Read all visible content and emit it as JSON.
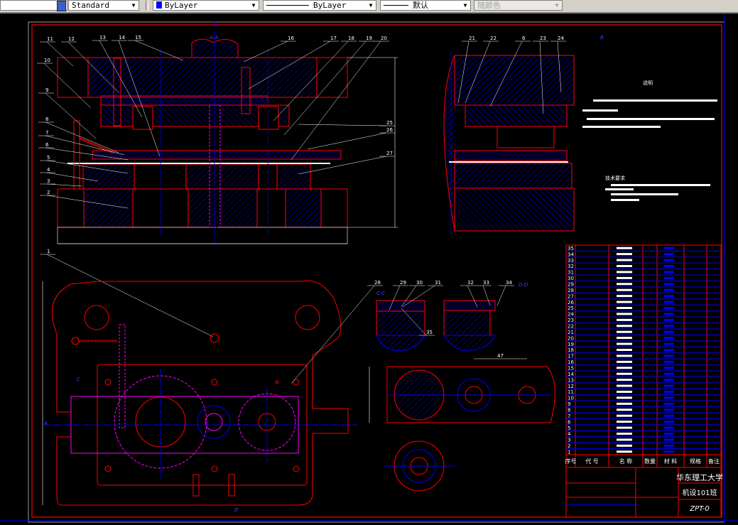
{
  "toolbar": {
    "text_style": "Standard",
    "color": "ByLayer",
    "color_swatch": "#0000ff",
    "linetype": "ByLayer",
    "lineweight": "默认",
    "plot_style": "随颜色"
  },
  "colors": {
    "background": "#000000",
    "outline": "#ff0000",
    "hatch": "#0000ff",
    "centerline": "#0000ff",
    "hidden": "#ff00ff",
    "leader": "#ffffff"
  },
  "drawing": {
    "section_labels": {
      "aa": "A-A",
      "cc": "C-C",
      "dd": "D-D",
      "a": "A",
      "b": "B",
      "c": "C",
      "d": "D"
    },
    "main_callouts": [
      "11",
      "12",
      "13",
      "14",
      "15",
      "16",
      "17",
      "18",
      "19",
      "20",
      "10",
      "9",
      "8",
      "7",
      "6",
      "5",
      "4",
      "3",
      "2",
      "25",
      "26",
      "27",
      "1"
    ],
    "side_callouts": [
      "21",
      "22",
      "6",
      "23",
      "24"
    ],
    "detail_callouts": [
      "28",
      "29",
      "30",
      "31",
      "32",
      "33",
      "34",
      "35"
    ],
    "dimension_pitch": "47",
    "notes_title": "说明",
    "tech_req_title": "技术要求"
  },
  "parts_list": {
    "headers": [
      "序号",
      "代 号",
      "名 称",
      "数量",
      "材 料",
      "规格",
      "备注"
    ],
    "rows": [
      "35",
      "34",
      "33",
      "32",
      "31",
      "30",
      "29",
      "28",
      "27",
      "26",
      "25",
      "24",
      "23",
      "22",
      "21",
      "20",
      "19",
      "18",
      "17",
      "16",
      "15",
      "14",
      "13",
      "12",
      "11",
      "10",
      "9",
      "8",
      "7",
      "6",
      "5",
      "4",
      "3",
      "2",
      "1"
    ]
  },
  "title_block": {
    "school": "华东理工大学",
    "class": "机设101班",
    "drawing_no": "ZPT-0"
  }
}
